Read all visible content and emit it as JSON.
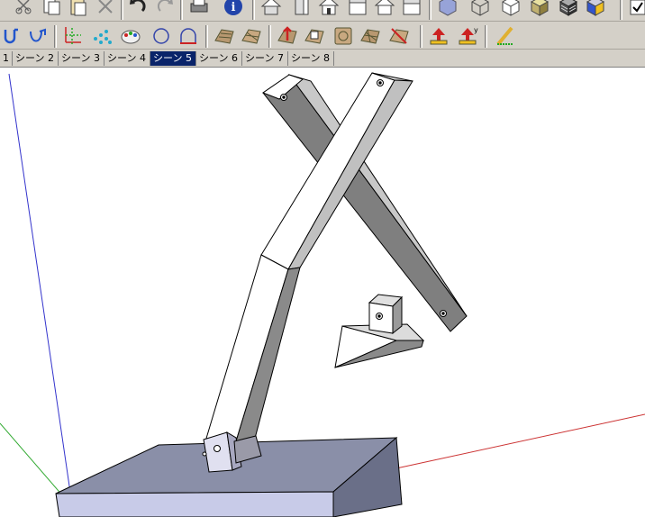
{
  "toolbar_main": {
    "tools": [
      "cut-icon",
      "copy-icon",
      "paste-icon",
      "erase-icon",
      "undo-icon",
      "redo-icon",
      "print-icon",
      "model-info-icon",
      "view-iso-icon",
      "view-top-icon",
      "view-front-icon",
      "view-right-icon",
      "view-back-icon",
      "view-left-icon",
      "xray-icon",
      "wireframe-icon",
      "hidden-line-icon",
      "shaded-icon",
      "shaded-texture-icon",
      "monochrome-icon"
    ]
  },
  "toolbar_sandbox": {
    "tools": [
      "follow-me-icon",
      "offset-icon",
      "axes-icon",
      "grid-points-icon",
      "paint-bucket-icon",
      "circle-icon",
      "arc-icon",
      "sandbox-from-contours-icon",
      "sandbox-from-scratch-icon",
      "smoove-icon",
      "stamp-icon",
      "drape-icon",
      "add-detail-icon",
      "flip-edge-icon",
      "orbit-red-icon",
      "orbit-yellow-icon",
      "pencil-ruler-icon"
    ]
  },
  "scene_tabs": {
    "items": [
      {
        "label": "1",
        "active": false
      },
      {
        "label": "シーン 2",
        "active": false
      },
      {
        "label": "シーン 3",
        "active": false
      },
      {
        "label": "シーン 4",
        "active": false
      },
      {
        "label": "シーン 5",
        "active": true
      },
      {
        "label": "シーン 6",
        "active": false
      },
      {
        "label": "シーン 7",
        "active": false
      },
      {
        "label": "シーン 8",
        "active": false
      }
    ]
  },
  "colors": {
    "toolbar_bg": "#d4d0c8",
    "active_tab": "#0a246a",
    "axis_red": "#cc3333",
    "axis_green": "#33aa33",
    "axis_blue": "#3333cc",
    "face_light": "#ffffff",
    "face_mid": "#c0c0c0",
    "face_dark": "#7f7f7f",
    "base_top": "#8a8fa8",
    "base_front": "#c8cbe8",
    "base_side": "#6a6f88"
  }
}
